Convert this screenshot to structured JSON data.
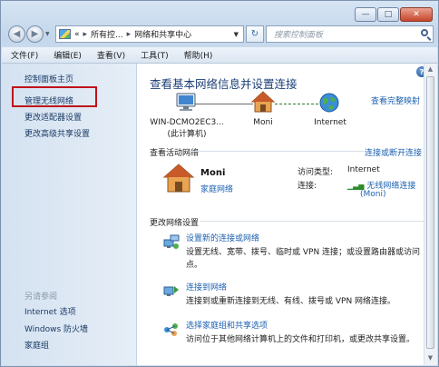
{
  "window": {
    "caption_buttons": [
      "—",
      "□",
      "✕"
    ]
  },
  "address_bar": {
    "overflow": "«",
    "crumbs": [
      "所有控...",
      "网络和共享中心"
    ],
    "search_placeholder": "搜索控制面板"
  },
  "menu": [
    "文件(F)",
    "编辑(E)",
    "查看(V)",
    "工具(T)",
    "帮助(H)"
  ],
  "sidebar": {
    "home": "控制面板主页",
    "tasks": [
      "管理无线网络",
      "更改适配器设置",
      "更改高级共享设置"
    ],
    "see_also_heading": "另请参阅",
    "see_also": [
      "Internet 选项",
      "Windows 防火墙",
      "家庭组"
    ],
    "highlighted": "管理无线网络"
  },
  "main": {
    "title": "查看基本网络信息并设置连接",
    "full_map_link": "查看完整映射",
    "nodes": [
      {
        "name": "WIN-DCMO2EC3...",
        "sub": "(此计算机)",
        "icon": "computer-icon"
      },
      {
        "name": "Moni",
        "sub": "",
        "icon": "house-icon"
      },
      {
        "name": "Internet",
        "sub": "",
        "icon": "globe-icon"
      }
    ],
    "active_section": "查看活动网络",
    "connect_link": "连接或断开连接",
    "network": {
      "name": "Moni",
      "type": "家庭网络",
      "access_label": "访问类型:",
      "access_value": "Internet",
      "conn_label": "连接:",
      "conn_value": "无线网络连接",
      "conn_sub": "(Moni)"
    },
    "change_section": "更改网络设置",
    "tasks": [
      {
        "title": "设置新的连接或网络",
        "desc": "设置无线、宽带、拨号、临时或 VPN 连接；或设置路由器或访问点。"
      },
      {
        "title": "连接到网络",
        "desc": "连接到或重新连接到无线、有线、拨号或 VPN 网络连接。"
      },
      {
        "title": "选择家庭组和共享选项",
        "desc": "访问位于其他网络计算机上的文件和打印机，或更改共享设置。"
      }
    ]
  },
  "colors": {
    "accent_link": "#1d61b0",
    "title": "#1b3f77",
    "highlight_box": "#c0121b"
  }
}
